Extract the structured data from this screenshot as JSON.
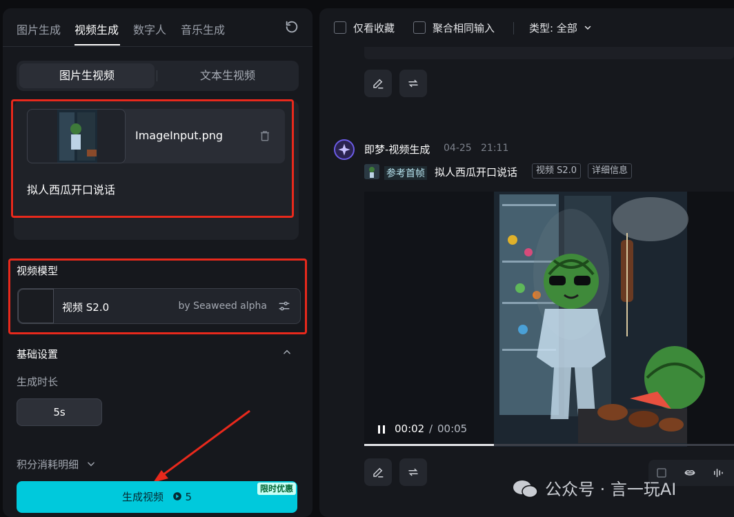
{
  "left_panel": {
    "tabs": [
      "图片生成",
      "视频生成",
      "数字人",
      "音乐生成"
    ],
    "active_tab_index": 1,
    "sub_tabs": [
      "图片生视频",
      "文本生视频"
    ],
    "active_sub_tab_index": 0,
    "upload": {
      "file_name": "ImageInput.png",
      "prompt": "拟人西瓜开口说话"
    },
    "model_section": {
      "title": "视频模型",
      "model_name": "视频 S2.0",
      "model_by": "by Seaweed alpha"
    },
    "basic_settings": {
      "title": "基础设置",
      "duration_label": "生成时长",
      "duration_value": "5s"
    },
    "points_detail": "积分消耗明细",
    "generate": {
      "label": "生成视频",
      "cost": "5",
      "promo_badge": "限时优惠"
    }
  },
  "right_panel": {
    "filters": {
      "favorites_only": "仅看收藏",
      "merge_same_input": "聚合相同输入",
      "type_select": "类型: 全部"
    },
    "message": {
      "author": "即梦-视频生成",
      "date": "04-25",
      "time": "21:11",
      "ref_label": "参考首帧",
      "prompt": "拟人西瓜开口说话",
      "tags": [
        "视频 S2.0",
        "详细信息"
      ]
    },
    "video": {
      "current_time": "00:02",
      "separator": "/",
      "total_time": "00:05",
      "progress": 0.35
    }
  },
  "watermark": {
    "text": "公众号 · 言一玩AI"
  },
  "colors": {
    "accent": "#00c9dc",
    "highlight_border": "#e8291c",
    "panel_bg": "#16181d",
    "page_bg": "#0c0d10"
  }
}
